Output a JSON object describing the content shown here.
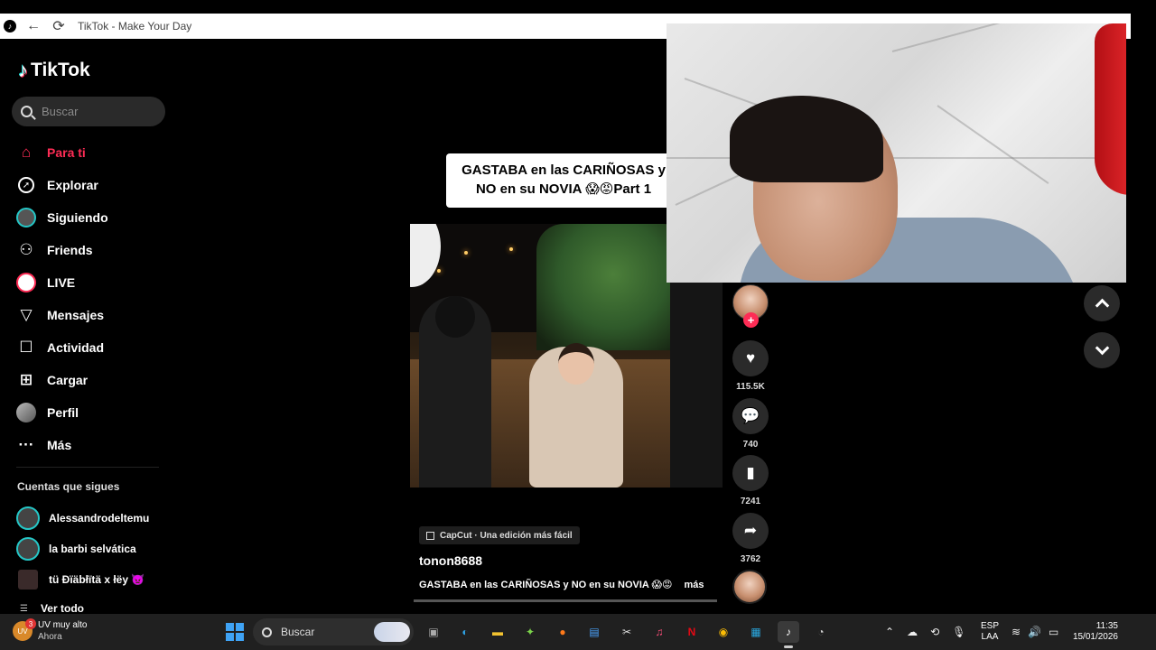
{
  "browser": {
    "title": "TikTok - Make Your Day"
  },
  "brand": {
    "name": "TikTok",
    "accent": "#fe2c55",
    "teal": "#25f4ee"
  },
  "sidebar": {
    "search_placeholder": "Buscar",
    "nav": [
      {
        "label": "Para ti",
        "icon": "home-icon",
        "active": true
      },
      {
        "label": "Explorar",
        "icon": "compass-icon"
      },
      {
        "label": "Siguiendo",
        "icon": "following-avatar-icon"
      },
      {
        "label": "Friends",
        "icon": "friends-icon"
      },
      {
        "label": "LIVE",
        "icon": "live-icon"
      },
      {
        "label": "Mensajes",
        "icon": "messages-icon"
      },
      {
        "label": "Actividad",
        "icon": "activity-icon"
      },
      {
        "label": "Cargar",
        "icon": "upload-icon"
      },
      {
        "label": "Perfil",
        "icon": "profile-avatar-icon"
      },
      {
        "label": "Más",
        "icon": "more-icon"
      }
    ],
    "following_title": "Cuentas que sigues",
    "following": [
      {
        "name": "Alessandrodeltemu"
      },
      {
        "name": "la barbi selvática"
      },
      {
        "name": "tü Đïäbłïtä x łëy 👿"
      }
    ],
    "see_all": "Ver todo"
  },
  "video": {
    "overlay_caption_line1": "GASTABA en las CARIÑOSAS y",
    "overlay_caption_line2": "NO en su NOVIA 😱😡Part 1",
    "capcut_label": "CapCut · Una edición más fácil",
    "author": "tonon8688",
    "description": "GASTABA en las CARIÑOSAS y NO en su NOVIA 😱😡",
    "more_label": "más"
  },
  "actions": {
    "likes": "115.5K",
    "comments": "740",
    "saves": "7241",
    "shares": "3762"
  },
  "taskbar": {
    "weather_title": "UV muy alto",
    "weather_sub": "Ahora",
    "weather_badge": "3",
    "weather_icon_text": "UV",
    "search_label": "Buscar",
    "lang_top": "ESP",
    "lang_bottom": "LAA",
    "time": "11:35",
    "date": "15/01/2026"
  }
}
